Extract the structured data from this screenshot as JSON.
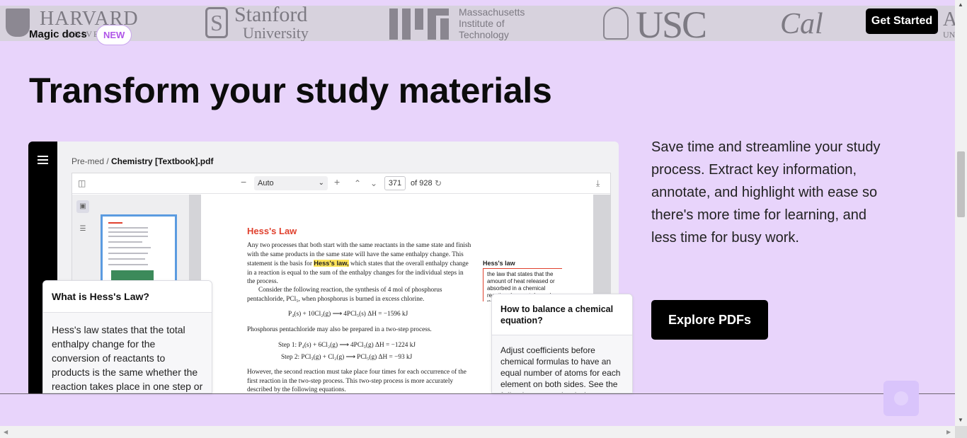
{
  "logos": {
    "harvard": "HARVARD",
    "harvard_sub": "UNIVERSITY",
    "stanford": "Stanford",
    "stanford_sub": "University",
    "mit": "Massachusetts Institute of Technology",
    "usc": "USC",
    "cal": "Cal",
    "edge": "AR",
    "edge_sub": "UNIV"
  },
  "nav": {
    "magic_docs_label": "Magic docs",
    "new_badge": "NEW",
    "get_started_label": "Get Started"
  },
  "hero": {
    "headline": "Transform your study materials",
    "description": "Save time and streamline your study process. Extract key information, annotate, and highlight with ease so there's more time for learning, and less time for busy work.",
    "explore_label": "Explore PDFs"
  },
  "viewer": {
    "breadcrumb_parent": "Pre-med / ",
    "breadcrumb_file": "Chemistry [Textbook].pdf",
    "zoom_value": "Auto",
    "page_number": "371",
    "page_total": "of 928",
    "page": {
      "heading": "Hess's Law",
      "para1_pre": "Any two processes that both start with the same reactants in the same state and finish with the same products in the same state will have the same enthalpy change. This statement is the basis for ",
      "para1_hl": "Hess's law,",
      "para1_post": " which states that the overall enthalpy change in a reaction is equal to the sum of the enthalpy changes for the individual steps in the process.",
      "para2": "Consider the following reaction, the synthesis of 4 mol of phosphorus pentachloride, PCl₅, when phosphorus is burned in excess chlorine.",
      "eq1": "P₄(s) + 10Cl₂(g) ⟶ 4PCl₅(s)    ΔH = −1596 kJ",
      "para3": "Phosphorus pentachloride may also be prepared in a two-step process.",
      "eq2": "Step 1: P₄(s) + 6Cl₂(g) ⟶ 4PCl₃(g)    ΔH = −1224 kJ",
      "eq3": "Step 2: PCl₃(g) + Cl₂(g) ⟶ PCl₅(g)    ΔH = −93 kJ",
      "para4": "However, the second reaction must take place four times for each occurrence of the first reaction in the two-step process. This two-step process is more accurately described by the following equations.",
      "margin_term": "Hess's law",
      "margin_def": "the law that states that the amount of heat released or absorbed in a chemical reaction does not depend on the number of steps"
    }
  },
  "cards": {
    "q1": "What is Hess's Law?",
    "a1": "Hess's law states that the total enthalpy change for the conversion of reactants to products is the same whether the reaction takes place in one step or",
    "q2": "How to balance a chemical equation?",
    "a2": "Adjust coefficients before chemical formulas to have an equal number of atoms for each element on both sides. See the following examples below."
  },
  "icons": {
    "menu": "menu-icon",
    "sidebar_toggle": "sidebar-toggle-icon",
    "zoom_out": "minus-icon",
    "zoom_in": "plus-icon",
    "page_up": "chevron-up-icon",
    "page_down": "chevron-down-icon",
    "refresh": "refresh-icon",
    "download": "download-icon",
    "chat": "chat-icon"
  },
  "colors": {
    "page_background": "#e8d4fb",
    "accent_badge": "#b056e8",
    "textbook_heading": "#e0412e",
    "highlight": "#ffe45a"
  }
}
